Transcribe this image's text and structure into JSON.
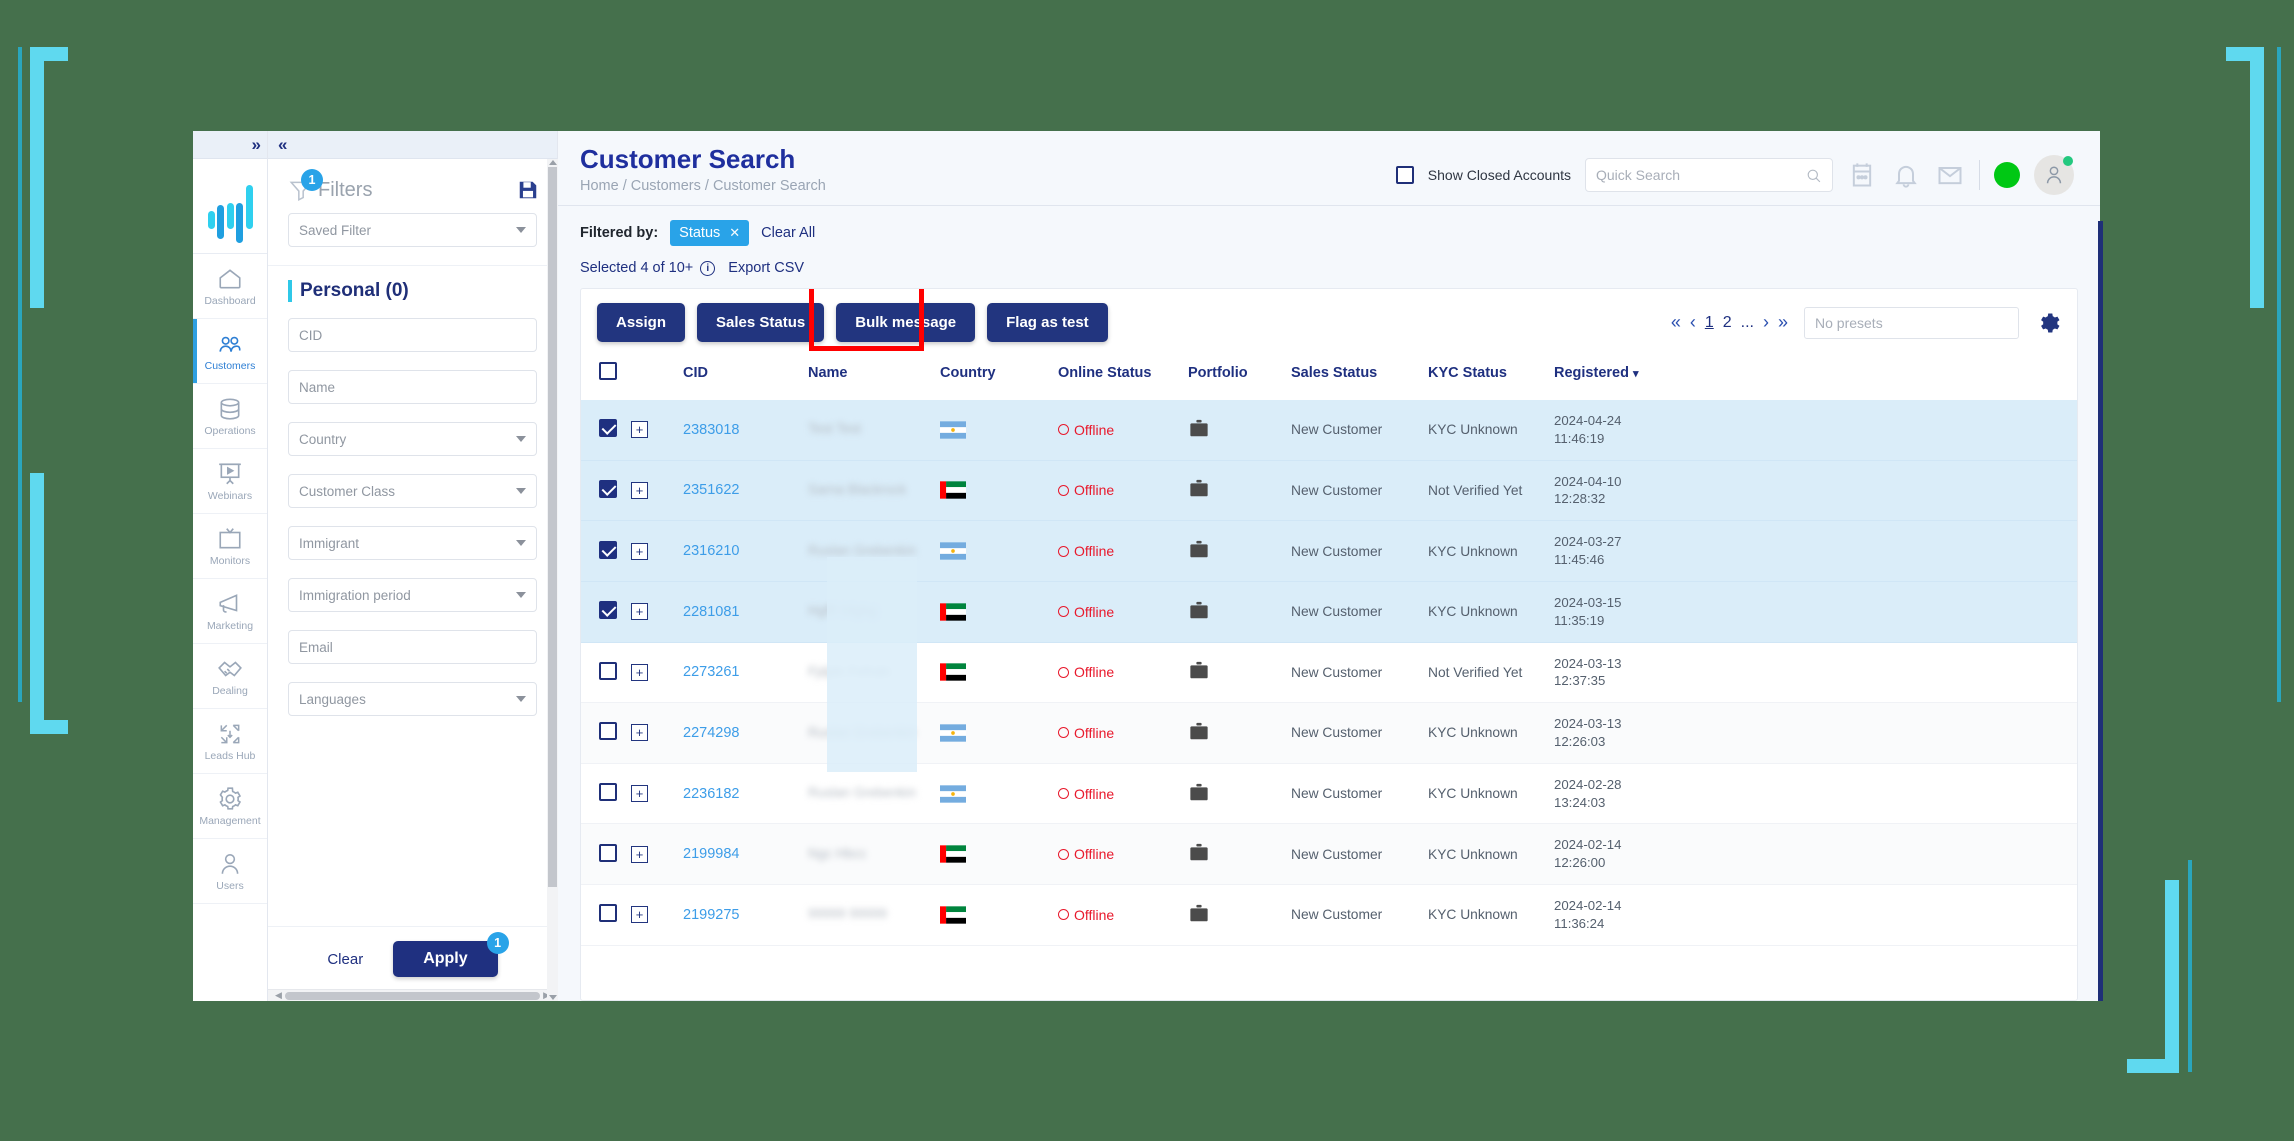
{
  "window": {
    "background_color": "#45704c",
    "bracket_color": "#5fd9ef",
    "accent_line_color": "#2aa6bd"
  },
  "rail": {
    "collapse_icon": "chevron-double-right-icon",
    "logo": "bar-chart-logo",
    "items": [
      {
        "label": "Dashboard",
        "icon": "home-icon",
        "active": false
      },
      {
        "label": "Customers",
        "icon": "users-icon",
        "active": true
      },
      {
        "label": "Operations",
        "icon": "database-icon",
        "active": false
      },
      {
        "label": "Webinars",
        "icon": "presentation-play-icon",
        "active": false
      },
      {
        "label": "Monitors",
        "icon": "monitor-icon",
        "active": false
      },
      {
        "label": "Marketing",
        "icon": "megaphone-icon",
        "active": false
      },
      {
        "label": "Dealing",
        "icon": "handshake-icon",
        "active": false
      },
      {
        "label": "Leads Hub",
        "icon": "arrows-expand-icon",
        "active": false
      },
      {
        "label": "Management",
        "icon": "gear-icon",
        "active": false
      },
      {
        "label": "Users",
        "icon": "person-icon",
        "active": false
      }
    ]
  },
  "filters": {
    "collapse_icon": "chevron-double-left-icon",
    "title": "Filters",
    "badge": "1",
    "save_icon": "floppy-save-icon",
    "saved_filter_placeholder": "Saved Filter",
    "section_title": "Personal (0)",
    "fields": [
      {
        "placeholder": "CID",
        "type": "text"
      },
      {
        "placeholder": "Name",
        "type": "text"
      },
      {
        "placeholder": "Country",
        "type": "select"
      },
      {
        "placeholder": "Customer Class",
        "type": "select"
      },
      {
        "placeholder": "Immigrant",
        "type": "select"
      },
      {
        "placeholder": "Immigration period",
        "type": "select"
      },
      {
        "placeholder": "Email",
        "type": "text"
      },
      {
        "placeholder": "Languages",
        "type": "select"
      }
    ],
    "clear_label": "Clear",
    "apply_label": "Apply",
    "apply_badge": "1"
  },
  "header": {
    "title": "Customer Search",
    "breadcrumb": "Home / Customers / Customer Search",
    "show_closed_label": "Show Closed Accounts",
    "show_closed_checked": false,
    "quick_search_placeholder": "Quick Search",
    "search_icon": "search-icon",
    "icons": [
      "calendar-icon",
      "bell-icon",
      "envelope-icon"
    ],
    "status_dot_color": "#00c814",
    "avatar_icon": "person-icon",
    "avatar_online": true
  },
  "filterbar": {
    "label": "Filtered by:",
    "chips": [
      {
        "label": "Status",
        "remove_icon": "close-icon"
      }
    ],
    "clear_all": "Clear All"
  },
  "selectionbar": {
    "selected_text": "Selected 4 of 10+",
    "info_icon": "info-icon",
    "export_label": "Export CSV"
  },
  "toolbar": {
    "buttons": [
      {
        "label": "Assign",
        "highlighted": false
      },
      {
        "label": "Sales Status",
        "highlighted": false
      },
      {
        "label": "Bulk message",
        "highlighted": true
      },
      {
        "label": "Flag as test",
        "highlighted": false
      }
    ],
    "pagination": {
      "first_icon": "chevron-double-left-icon",
      "prev_icon": "chevron-left-icon",
      "pages": [
        "1",
        "2",
        "..."
      ],
      "current_page": "1",
      "next_icon": "chevron-right-icon",
      "last_icon": "chevron-double-right-icon"
    },
    "presets_placeholder": "No presets",
    "settings_icon": "gear-icon"
  },
  "table": {
    "select_all_checked": false,
    "columns": [
      "CID",
      "Name",
      "Country",
      "Online Status",
      "Portfolio",
      "Sales Status",
      "KYC Status",
      "Registered"
    ],
    "sort_column": "Registered",
    "sort_icon": "caret-down-icon",
    "rows": [
      {
        "selected": true,
        "cid": "2383018",
        "name": "Test Test",
        "country": "AR",
        "online": "Offline",
        "portfolio": "briefcase-icon",
        "sales_status": "New Customer",
        "kyc": "KYC Unknown",
        "registered_date": "2024-04-24",
        "registered_time": "11:46:19"
      },
      {
        "selected": true,
        "cid": "2351622",
        "name": "Sarna Blackrock",
        "country": "AE",
        "online": "Offline",
        "portfolio": "briefcase-icon",
        "sales_status": "New Customer",
        "kyc": "Not Verified Yet",
        "registered_date": "2024-04-10",
        "registered_time": "12:28:32"
      },
      {
        "selected": true,
        "cid": "2316210",
        "name": "Ruslan Grebenkin",
        "country": "AR",
        "online": "Offline",
        "portfolio": "briefcase-icon",
        "sales_status": "New Customer",
        "kyc": "KYC Unknown",
        "registered_date": "2024-03-27",
        "registered_time": "11:45:46"
      },
      {
        "selected": true,
        "cid": "2281081",
        "name": "Hgfff Gfghg",
        "country": "AE",
        "online": "Offline",
        "portfolio": "briefcase-icon",
        "sales_status": "New Customer",
        "kyc": "KYC Unknown",
        "registered_date": "2024-03-15",
        "registered_time": "11:35:19"
      },
      {
        "selected": false,
        "cid": "2273261",
        "name": "Fjdjdn Fefndn",
        "country": "AE",
        "online": "Offline",
        "portfolio": "briefcase-icon",
        "sales_status": "New Customer",
        "kyc": "Not Verified Yet",
        "registered_date": "2024-03-13",
        "registered_time": "12:37:35"
      },
      {
        "selected": false,
        "cid": "2274298",
        "name": "Ruslan Grebenkin",
        "country": "AR",
        "online": "Offline",
        "portfolio": "briefcase-icon",
        "sales_status": "New Customer",
        "kyc": "KYC Unknown",
        "registered_date": "2024-03-13",
        "registered_time": "12:26:03"
      },
      {
        "selected": false,
        "cid": "2236182",
        "name": "Ruslan Grebenkin",
        "country": "AR",
        "online": "Offline",
        "portfolio": "briefcase-icon",
        "sales_status": "New Customer",
        "kyc": "KYC Unknown",
        "registered_date": "2024-02-28",
        "registered_time": "13:24:03"
      },
      {
        "selected": false,
        "cid": "2199984",
        "name": "Ngc Hbcc",
        "country": "AE",
        "online": "Offline",
        "portfolio": "briefcase-icon",
        "sales_status": "New Customer",
        "kyc": "KYC Unknown",
        "registered_date": "2024-02-14",
        "registered_time": "12:26:00"
      },
      {
        "selected": false,
        "cid": "2199275",
        "name": "99999 99999",
        "country": "AE",
        "online": "Offline",
        "portfolio": "briefcase-icon",
        "sales_status": "New Customer",
        "kyc": "KYC Unknown",
        "registered_date": "2024-02-14",
        "registered_time": "11:36:24"
      }
    ]
  }
}
